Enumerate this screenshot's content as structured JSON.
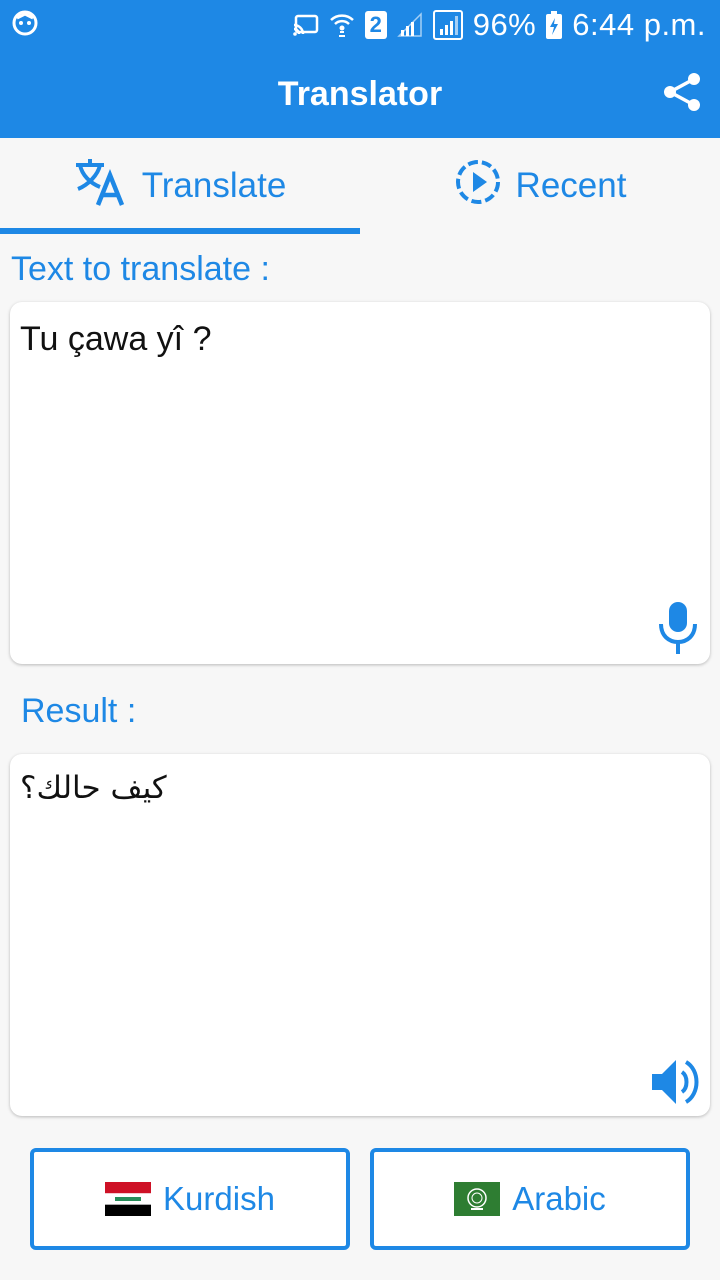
{
  "status_bar": {
    "battery": "96%",
    "time": "6:44 p.m.",
    "sim_badge": "2"
  },
  "app_bar": {
    "title": "Translator",
    "share_icon": "share-icon"
  },
  "tabs": [
    {
      "label": "Translate",
      "icon": "translate-icon",
      "active": true
    },
    {
      "label": "Recent",
      "icon": "recent-play-icon",
      "active": false
    }
  ],
  "input": {
    "label": "Text to translate :",
    "value": "Tu çawa yî ?",
    "action_icon": "microphone-icon"
  },
  "result": {
    "label": "Result :",
    "value": "كيف حالك؟",
    "action_icon": "speaker-icon"
  },
  "languages": {
    "source": {
      "label": "Kurdish",
      "flag": "iraq-flag"
    },
    "target": {
      "label": "Arabic",
      "flag": "arab-league-flag"
    }
  },
  "colors": {
    "accent": "#1e88e5",
    "background": "#f7f7f7",
    "card": "#ffffff"
  }
}
